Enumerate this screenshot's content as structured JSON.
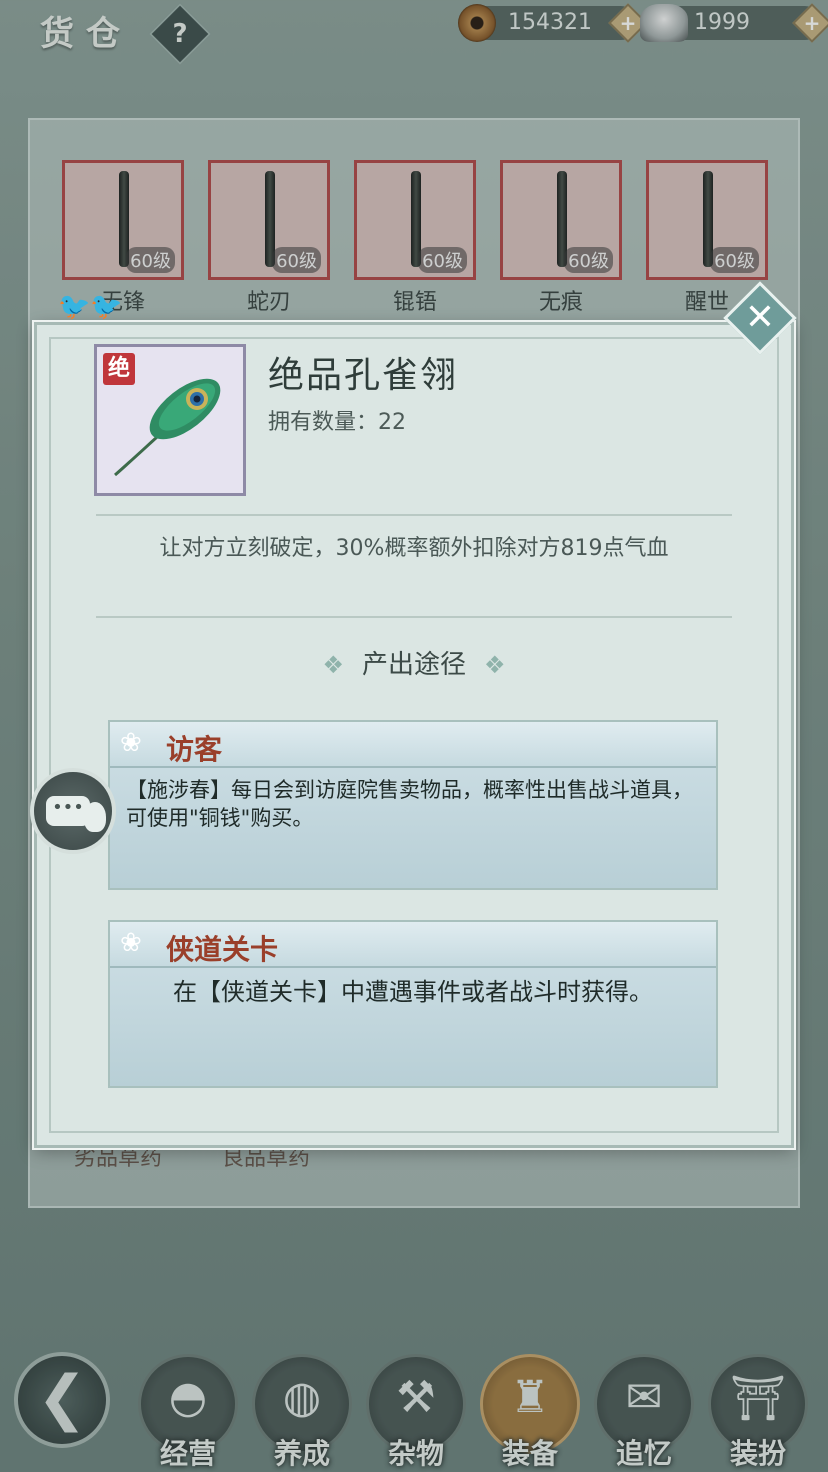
{
  "header": {
    "title": "货仓",
    "help_label": "?",
    "copper": {
      "value": "154321",
      "plus": "+"
    },
    "silver": {
      "value": "1999",
      "plus": "+"
    }
  },
  "weapons": [
    {
      "name": "无锋",
      "level": "60级"
    },
    {
      "name": "蛇刃",
      "level": "60级"
    },
    {
      "name": "锟铻",
      "level": "60级"
    },
    {
      "name": "无痕",
      "level": "60级"
    },
    {
      "name": "醒世",
      "level": "60级"
    }
  ],
  "behind_items": [
    "劣品草药",
    "良品草药"
  ],
  "modal": {
    "close_label": "✕",
    "item": {
      "grade_tag": "绝",
      "name": "绝品孔雀翎",
      "count_label": "拥有数量：",
      "count_value": "22",
      "description": "让对方立刻破定，30%概率额外扣除对方819点气血"
    },
    "sources_title": "产出途径",
    "sources": [
      {
        "title": "访客",
        "text": "【施涉春】每日会到访庭院售卖物品，概率性出售战斗道具，可使用\"铜钱\"购买。"
      },
      {
        "title": "侠道关卡",
        "text": "在【侠道关卡】中遭遇事件或者战斗时获得。"
      }
    ]
  },
  "nav": {
    "back_glyph": "❮",
    "items": [
      {
        "label": "经营",
        "glyph": "◓",
        "active": false
      },
      {
        "label": "养成",
        "glyph": "◍",
        "active": false
      },
      {
        "label": "杂物",
        "glyph": "⚒",
        "active": false
      },
      {
        "label": "装备",
        "glyph": "♜",
        "active": true
      },
      {
        "label": "追忆",
        "glyph": "✉",
        "active": false
      },
      {
        "label": "装扮",
        "glyph": "⛩",
        "active": false
      }
    ]
  },
  "colors": {
    "accent": "#9a3f2a",
    "panel": "#dbe6e3",
    "rarity_tag": "#c0363b"
  }
}
